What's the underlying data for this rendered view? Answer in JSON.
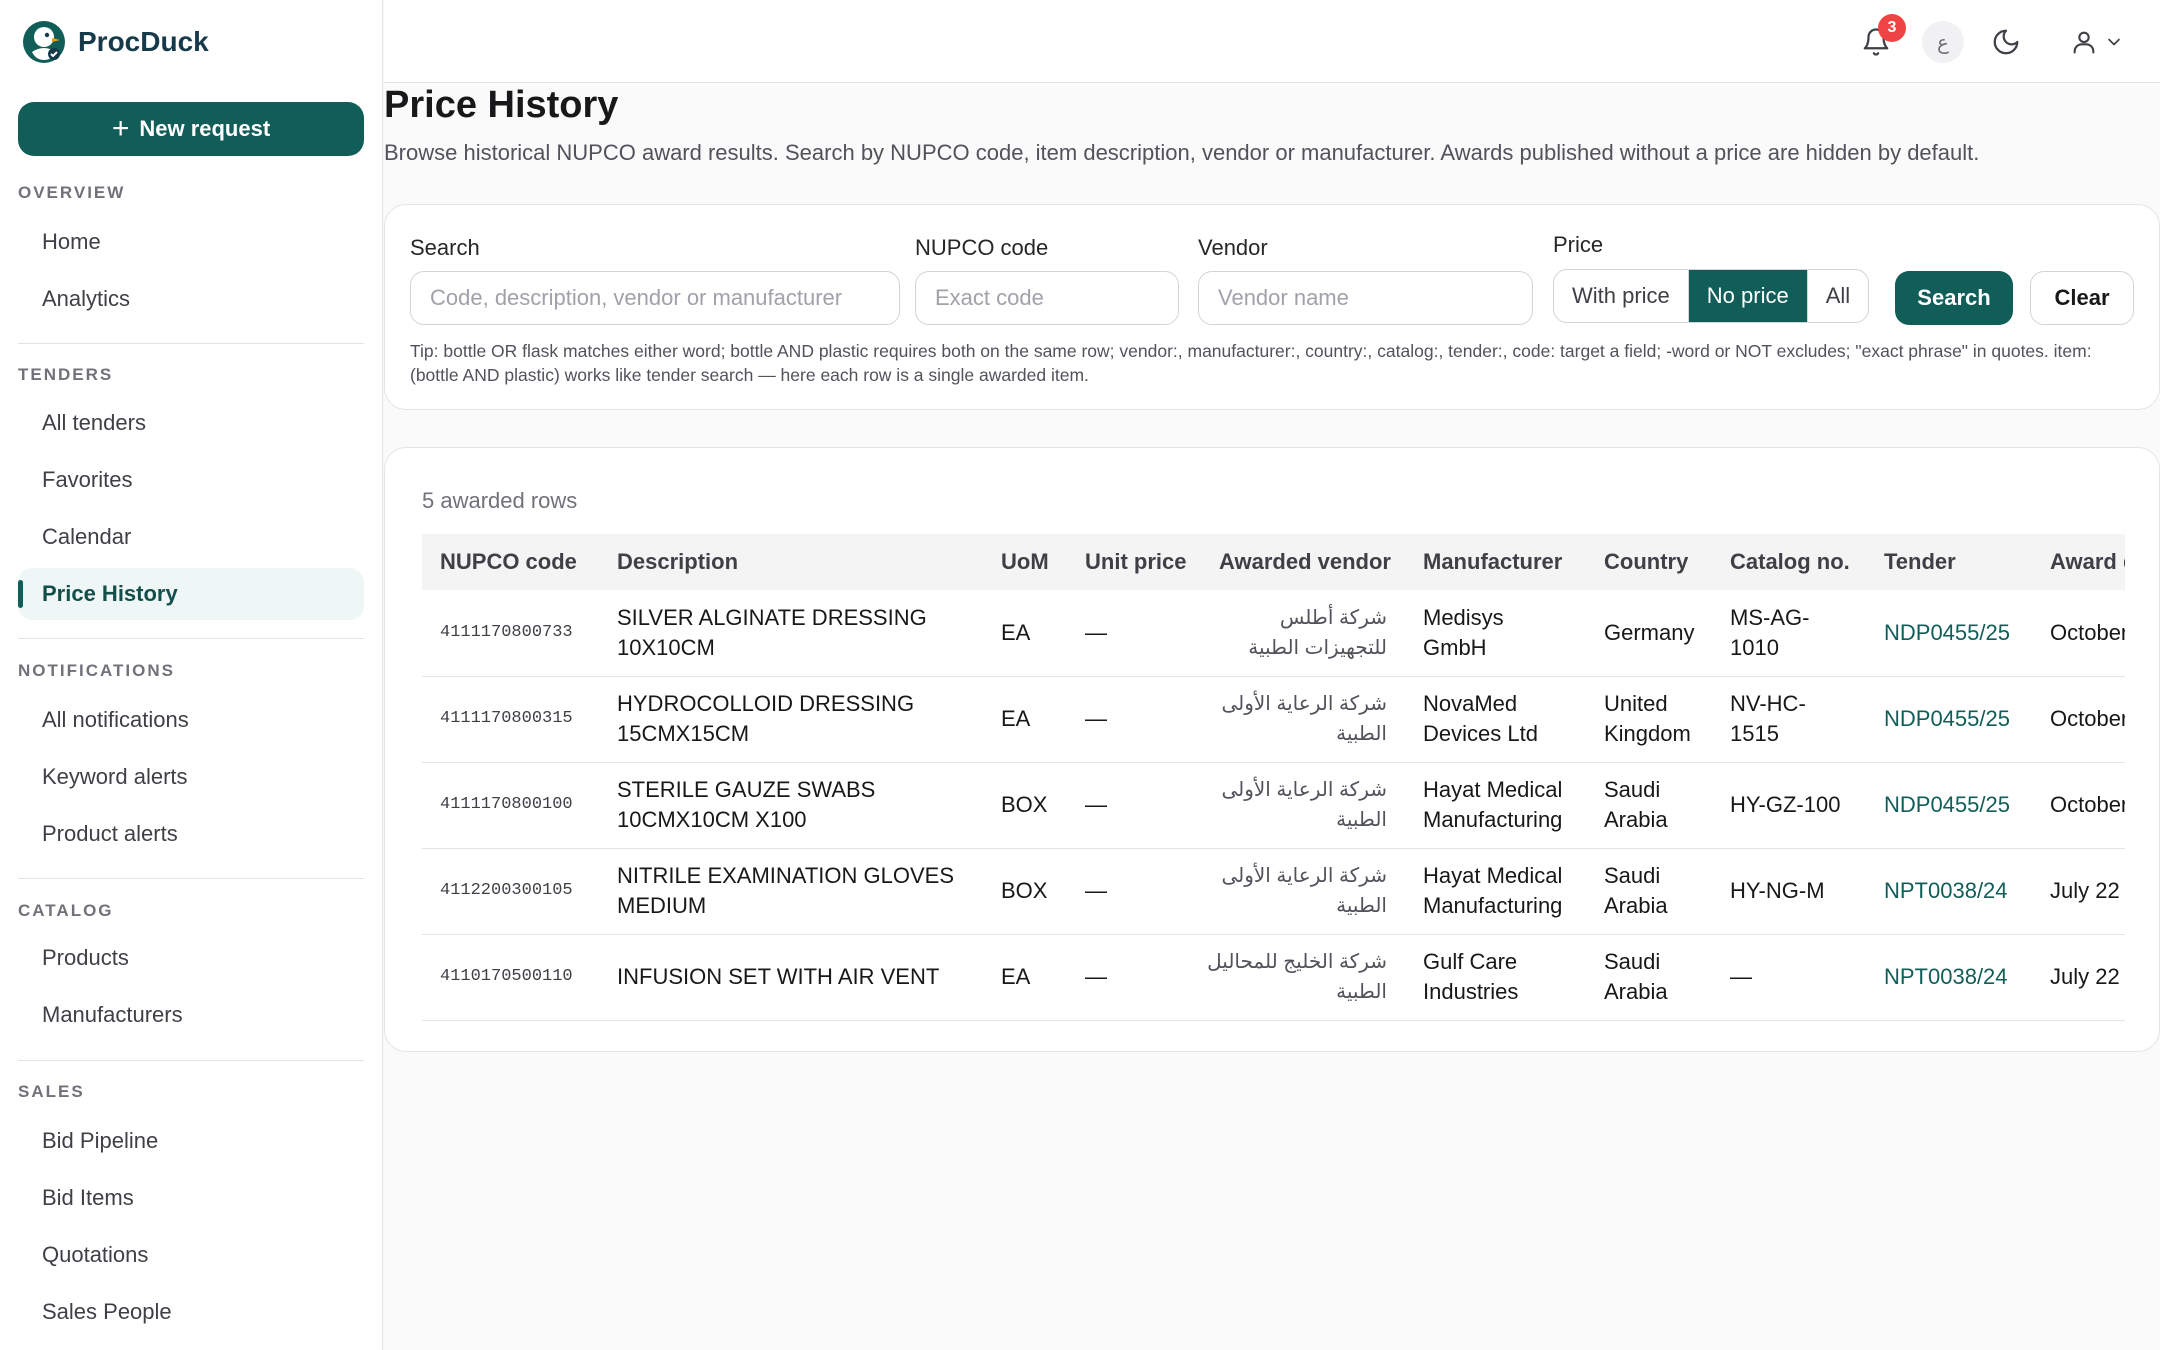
{
  "brand": {
    "name": "ProcDuck"
  },
  "sidebar": {
    "new_request": "New request",
    "sections": [
      {
        "heading": "OVERVIEW",
        "items": [
          "Home",
          "Analytics"
        ]
      },
      {
        "heading": "TENDERS",
        "items": [
          "All tenders",
          "Favorites",
          "Calendar",
          "Price History"
        ]
      },
      {
        "heading": "NOTIFICATIONS",
        "items": [
          "All notifications",
          "Keyword alerts",
          "Product alerts"
        ]
      },
      {
        "heading": "CATALOG",
        "items": [
          "Products",
          "Manufacturers"
        ]
      },
      {
        "heading": "SALES",
        "items": [
          "Bid Pipeline",
          "Bid Items",
          "Quotations",
          "Sales People"
        ]
      }
    ],
    "active_item": "Price History"
  },
  "topbar": {
    "notification_count": "3",
    "language_toggle": "ع"
  },
  "page": {
    "title": "Price History",
    "description": "Browse historical NUPCO award results. Search by NUPCO code, item description, vendor or manufacturer. Awards published without a price are hidden by default."
  },
  "filters": {
    "search_label": "Search",
    "search_placeholder": "Code, description, vendor or manufacturer",
    "code_label": "NUPCO code",
    "code_placeholder": "Exact code",
    "vendor_label": "Vendor",
    "vendor_placeholder": "Vendor name",
    "price_label": "Price",
    "price_options": [
      "With price",
      "No price",
      "All"
    ],
    "price_selected": "No price",
    "search_button": "Search",
    "clear_button": "Clear",
    "tip": "Tip: bottle OR flask matches either word; bottle AND plastic requires both on the same row; vendor:, manufacturer:, country:, catalog:, tender:, code: target a field; -word or NOT excludes; \"exact phrase\" in quotes. item:(bottle AND plastic) works like tender search — here each row is a single awarded item."
  },
  "results": {
    "count_text": "5 awarded rows",
    "columns": [
      "NUPCO code",
      "Description",
      "UoM",
      "Unit price",
      "Awarded vendor",
      "Manufacturer",
      "Country",
      "Catalog no.",
      "Tender",
      "Award date"
    ],
    "rows": [
      {
        "code": "4111170800733",
        "description": "SILVER ALGINATE DRESSING 10X10CM",
        "uom": "EA",
        "unit_price": "—",
        "vendor": "شركة أطلس للتجهيزات الطبية",
        "manufacturer": "Medisys GmbH",
        "country": "Germany",
        "catalog": "MS-AG-1010",
        "tender": "NDP0455/25",
        "award_date": "October"
      },
      {
        "code": "4111170800315",
        "description": "HYDROCOLLOID DRESSING 15CMX15CM",
        "uom": "EA",
        "unit_price": "—",
        "vendor": "شركة الرعاية الأولى الطبية",
        "manufacturer": "NovaMed Devices Ltd",
        "country": "United Kingdom",
        "catalog": "NV-HC-1515",
        "tender": "NDP0455/25",
        "award_date": "October"
      },
      {
        "code": "4111170800100",
        "description": "STERILE GAUZE SWABS 10CMX10CM X100",
        "uom": "BOX",
        "unit_price": "—",
        "vendor": "شركة الرعاية الأولى الطبية",
        "manufacturer": "Hayat Medical Manufacturing",
        "country": "Saudi Arabia",
        "catalog": "HY-GZ-100",
        "tender": "NDP0455/25",
        "award_date": "October"
      },
      {
        "code": "4112200300105",
        "description": "NITRILE EXAMINATION GLOVES MEDIUM",
        "uom": "BOX",
        "unit_price": "—",
        "vendor": "شركة الرعاية الأولى الطبية",
        "manufacturer": "Hayat Medical Manufacturing",
        "country": "Saudi Arabia",
        "catalog": "HY-NG-M",
        "tender": "NPT0038/24",
        "award_date": "July 22"
      },
      {
        "code": "4110170500110",
        "description": "INFUSION SET WITH AIR VENT",
        "uom": "EA",
        "unit_price": "—",
        "vendor": "شركة الخليج للمحاليل الطبية",
        "manufacturer": "Gulf Care Industries",
        "country": "Saudi Arabia",
        "catalog": "—",
        "tender": "NPT0038/24",
        "award_date": "July 22"
      }
    ]
  }
}
